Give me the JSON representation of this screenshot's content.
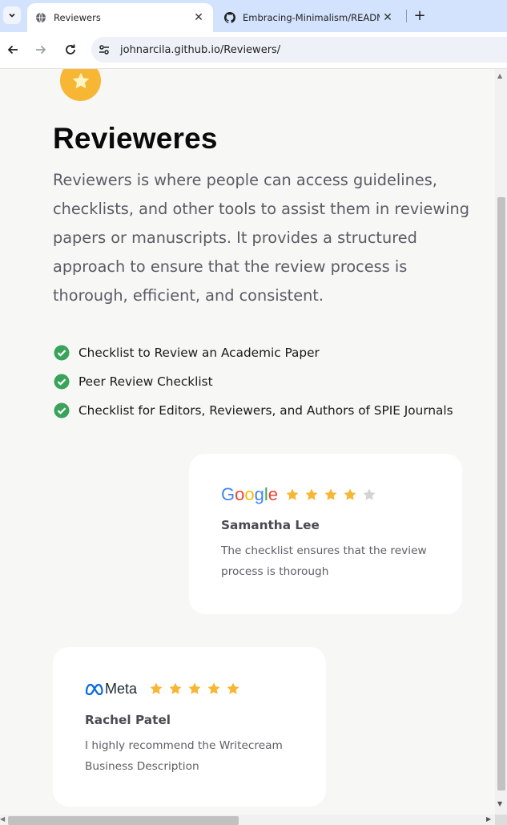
{
  "browser": {
    "tabs": [
      {
        "title": "Reviewers",
        "favicon": "globe-icon",
        "active": true
      },
      {
        "title": "Embracing-Minimalism/READM",
        "favicon": "github-icon",
        "active": false
      }
    ],
    "new_tab": "+",
    "close_glyph": "✕",
    "url": "johnarcila.github.io/Reviewers/"
  },
  "page": {
    "title": "Revieweres",
    "lead": "Reviewers is where people can access guidelines, checklists, and other tools to assist them in reviewing papers or manuscripts. It provides a structured approach to ensure that the review process is thorough, efficient, and consistent.",
    "checklist": [
      "Checklist to Review an Academic Paper",
      "Peer Review Checklist",
      "Checklist for Editors, Reviewers, and Authors of SPIE Journals"
    ]
  },
  "reviews": [
    {
      "brand": "Google",
      "rating": 4,
      "max_rating": 5,
      "name": "Samantha Lee",
      "text": "The checklist ensures that the review process is thorough"
    },
    {
      "brand": "Meta",
      "rating": 5,
      "max_rating": 5,
      "name": "Rachel Patel",
      "text": "I highly recommend the Writecream Business Description"
    }
  ],
  "colors": {
    "accent_star": "#f7b633",
    "check_green": "#3aa35a",
    "star_empty": "#d3d3d3",
    "google_blue": "#4285F4",
    "google_red": "#EA4335",
    "google_yellow": "#FBBC05",
    "google_green": "#34A853",
    "meta_blue": "#0668E1"
  }
}
